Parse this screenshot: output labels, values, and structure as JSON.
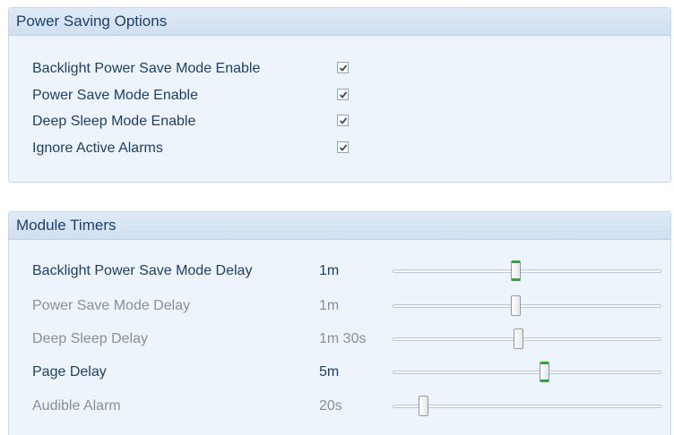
{
  "power_saving": {
    "title": "Power Saving Options",
    "options": [
      {
        "label": "Backlight Power Save Mode Enable",
        "checked": true
      },
      {
        "label": "Power Save Mode Enable",
        "checked": true
      },
      {
        "label": "Deep Sleep Mode Enable",
        "checked": true
      },
      {
        "label": "Ignore Active Alarms",
        "checked": true
      }
    ]
  },
  "module_timers": {
    "title": "Module Timers",
    "timers": [
      {
        "label": "Backlight Power Save Mode Delay",
        "value": "1m",
        "enabled": true,
        "slider_fraction": 0.455
      },
      {
        "label": "Power Save Mode Delay",
        "value": "1m",
        "enabled": false,
        "slider_fraction": 0.455
      },
      {
        "label": "Deep Sleep Delay",
        "value": "1m 30s",
        "enabled": false,
        "slider_fraction": 0.465
      },
      {
        "label": "Page Delay",
        "value": "5m",
        "enabled": true,
        "slider_fraction": 0.565
      },
      {
        "label": "Audible Alarm",
        "value": "20s",
        "enabled": false,
        "slider_fraction": 0.11
      }
    ]
  },
  "colors": {
    "panel_bg": "#eef4fc",
    "header_text": "#1e3f66",
    "disabled_text": "#8a8f96",
    "active_slider_accent": "#2aa63a"
  }
}
